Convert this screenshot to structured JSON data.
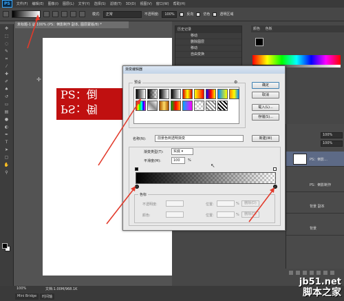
{
  "app": {
    "logo": "PS",
    "menu": [
      "文件(F)",
      "编辑(E)",
      "图像(I)",
      "图层(L)",
      "文字(Y)",
      "选择(S)",
      "滤镜(T)",
      "3D(D)",
      "视图(V)",
      "窗口(W)",
      "帮助(H)"
    ]
  },
  "options_bar": {
    "mode_label": "模式:",
    "mode_value": "正常",
    "opacity_label": "不透明度:",
    "opacity_value": "100%",
    "reverse_label": "反向",
    "dither_label": "仿色",
    "transparency_label": "透明区域"
  },
  "document": {
    "tab_title": "未标题-1 @ 100% (PS：倒影制作 副本, 图层蒙版/8) *",
    "text_line": "PS：倒",
    "text_mirror": "PS：倒"
  },
  "history": {
    "title": "历史记录",
    "items": [
      "移动",
      "删除图层",
      "移动",
      "自由变换"
    ]
  },
  "swatches_panel": {
    "title": "颜色",
    "tab2": "色板"
  },
  "layers": {
    "opacity_value": "100%",
    "fill_value": "100%",
    "rows": [
      {
        "name": "PS：倒影..."
      },
      {
        "name": "PS：倒影制作"
      },
      {
        "name": "背景 副本"
      },
      {
        "name": "背景"
      }
    ]
  },
  "status": {
    "zoom": "100%",
    "doc": "文档:1.00M/968.1K",
    "tabs": [
      "Mini Bridge",
      "时间轴"
    ]
  },
  "watermark": {
    "url": "jb51.net",
    "name": "脚本之家"
  },
  "dialog": {
    "title": "渐变编辑器",
    "presets_legend": "预设",
    "buttons": {
      "ok": "确定",
      "cancel": "取消",
      "load": "载入(L)...",
      "save": "存储(S)...",
      "new": "新建(W)"
    },
    "name_label": "名称(N):",
    "name_value": "前景色到透明渐变",
    "type_label": "渐变类型(T):",
    "type_value": "实底",
    "smooth_label": "平滑度(M):",
    "smooth_value": "100",
    "smooth_unit": "%",
    "stops_legend": "色标",
    "opacity_label": "不透明度:",
    "location_label": "位置:",
    "delete_label": "删除(D)",
    "color_label": "颜色:",
    "location_label2": "位置:",
    "delete_label2": "删除(D)",
    "percent": "%",
    "percent2": "%"
  },
  "colors": {
    "arrow": "#e23a2b",
    "doc_text_bg": "#c01010",
    "highlight": "#5d6a86"
  }
}
